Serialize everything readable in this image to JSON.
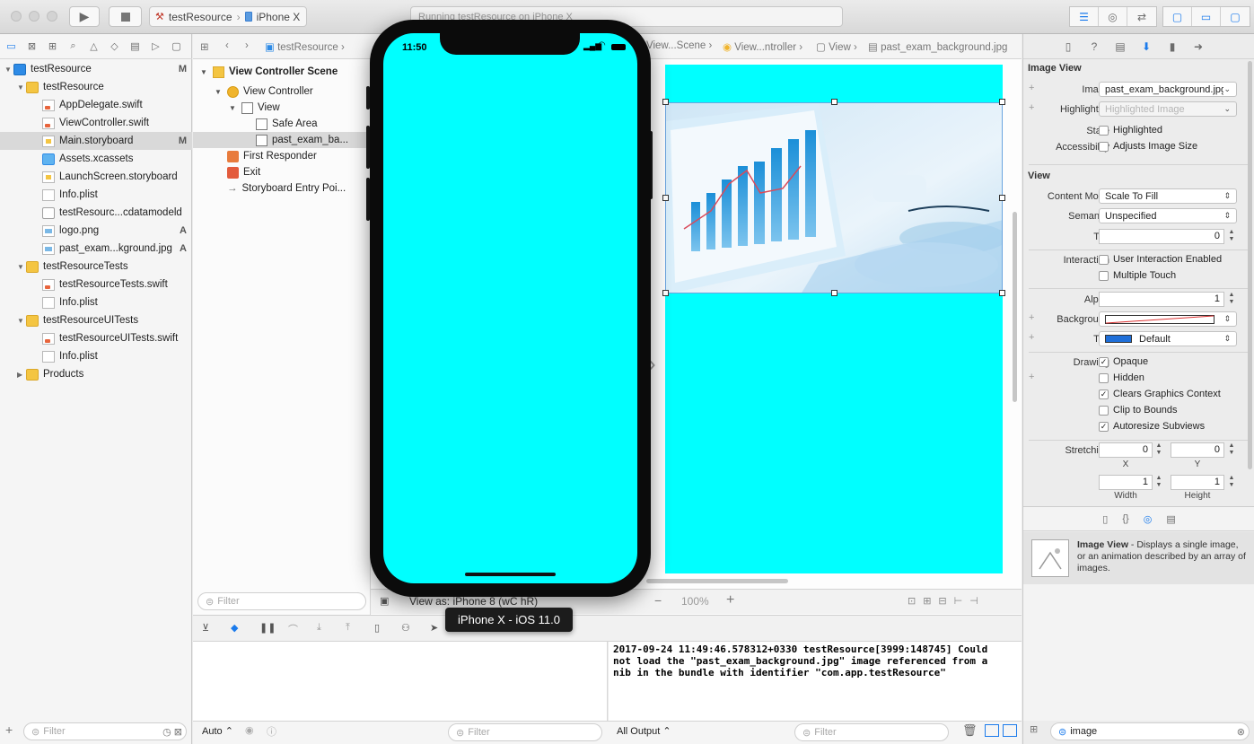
{
  "toolbar": {
    "scheme_target": "testResource",
    "scheme_device": "iPhone X",
    "activity_status": "Running testResource on iPhone X"
  },
  "navigator": {
    "items": [
      {
        "label": "testResource",
        "badge": "M"
      },
      {
        "label": "testResource",
        "badge": ""
      },
      {
        "label": "AppDelegate.swift",
        "badge": ""
      },
      {
        "label": "ViewController.swift",
        "badge": ""
      },
      {
        "label": "Main.storyboard",
        "badge": "M"
      },
      {
        "label": "Assets.xcassets",
        "badge": ""
      },
      {
        "label": "LaunchScreen.storyboard",
        "badge": ""
      },
      {
        "label": "Info.plist",
        "badge": ""
      },
      {
        "label": "testResourc...cdatamodeld",
        "badge": ""
      },
      {
        "label": "logo.png",
        "badge": "A"
      },
      {
        "label": "past_exam...kground.jpg",
        "badge": "A"
      },
      {
        "label": "testResourceTests",
        "badge": ""
      },
      {
        "label": "testResourceTests.swift",
        "badge": ""
      },
      {
        "label": "Info.plist",
        "badge": ""
      },
      {
        "label": "testResourceUITests",
        "badge": ""
      },
      {
        "label": "testResourceUITests.swift",
        "badge": ""
      },
      {
        "label": "Info.plist",
        "badge": ""
      },
      {
        "label": "Products",
        "badge": ""
      }
    ],
    "filter_placeholder": "Filter"
  },
  "jumpbar": {
    "crumbs": [
      "testResource",
      "View...Scene",
      "View...ntroller",
      "View",
      "past_exam_background.jpg"
    ]
  },
  "outline": {
    "items": [
      "View Controller Scene",
      "View Controller",
      "View",
      "Safe Area",
      "past_exam_ba...",
      "First Responder",
      "Exit",
      "Storyboard Entry Poi..."
    ],
    "filter_placeholder": "Filter"
  },
  "simulator": {
    "time": "11:50",
    "tooltip": "iPhone X - iOS 11.0"
  },
  "canvasbar": {
    "view_as": "View as: iPhone 8 (wC hR)",
    "zoom": "100%"
  },
  "console": {
    "text": "2017-09-24 11:49:46.578312+0330 testResource[3999:148745] Could\nnot load the \"past_exam_background.jpg\" image referenced from a\nnib in the bundle with identifier \"com.app.testResource\"",
    "output_select": "All Output",
    "auto_select": "Auto",
    "filter_placeholder": "Filter"
  },
  "inspector": {
    "image_view_section": "Image View",
    "image_label": "Image",
    "image_value": "past_exam_background.jpg",
    "highlighted_label": "Highlighted",
    "highlighted_placeholder": "Highlighted Image",
    "state_label": "State",
    "state_check": "Highlighted",
    "accessibility_label": "Accessibility",
    "accessibility_check": "Adjusts Image Size",
    "view_section": "View",
    "content_mode_label": "Content Mode",
    "content_mode_value": "Scale To Fill",
    "semantic_label": "Semantic",
    "semantic_value": "Unspecified",
    "tag_label": "Tag",
    "tag_value": "0",
    "interaction_label": "Interaction",
    "user_interaction": "User Interaction Enabled",
    "multiple_touch": "Multiple Touch",
    "alpha_label": "Alpha",
    "alpha_value": "1",
    "background_label": "Background",
    "tint_label": "Tint",
    "tint_value": "Default",
    "drawing_label": "Drawing",
    "opaque": "Opaque",
    "hidden": "Hidden",
    "clears_graphics": "Clears Graphics Context",
    "clip_to_bounds": "Clip to Bounds",
    "autoresize": "Autoresize Subviews",
    "stretching_label": "Stretching",
    "stretch_x": "0",
    "stretch_y": "0",
    "stretch_w": "1",
    "stretch_h": "1",
    "x_label": "X",
    "y_label": "Y",
    "width_label": "Width",
    "height_label": "Height",
    "lib_title": "Image View",
    "lib_desc": " - Displays a single image, or an animation described by an array of images.",
    "search_value": "image"
  },
  "colors": {
    "scene_background": "#00ffff",
    "accent": "#1b7bec",
    "tint_swatch": "#1f6fd9"
  }
}
